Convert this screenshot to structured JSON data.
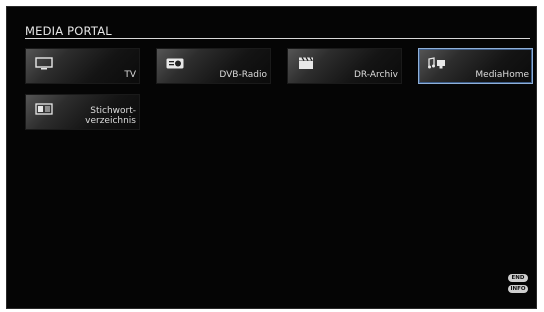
{
  "portal": {
    "title": "MEDIA PORTAL"
  },
  "tiles": [
    {
      "label": "TV",
      "icon": "tv-icon",
      "selected": false
    },
    {
      "label": "DVB-Radio",
      "icon": "radio-icon",
      "selected": false
    },
    {
      "label": "DR-Archiv",
      "icon": "clapperboard-icon",
      "selected": false
    },
    {
      "label": "MediaHome",
      "icon": "media-home-icon",
      "selected": true
    },
    {
      "label": "Stichwort-\nverzeichnis",
      "icon": "index-icon",
      "selected": false
    }
  ],
  "hints": {
    "end": "END",
    "info": "INFO"
  },
  "colors": {
    "selection_border": "#8fb0d8",
    "background": "#050505"
  }
}
